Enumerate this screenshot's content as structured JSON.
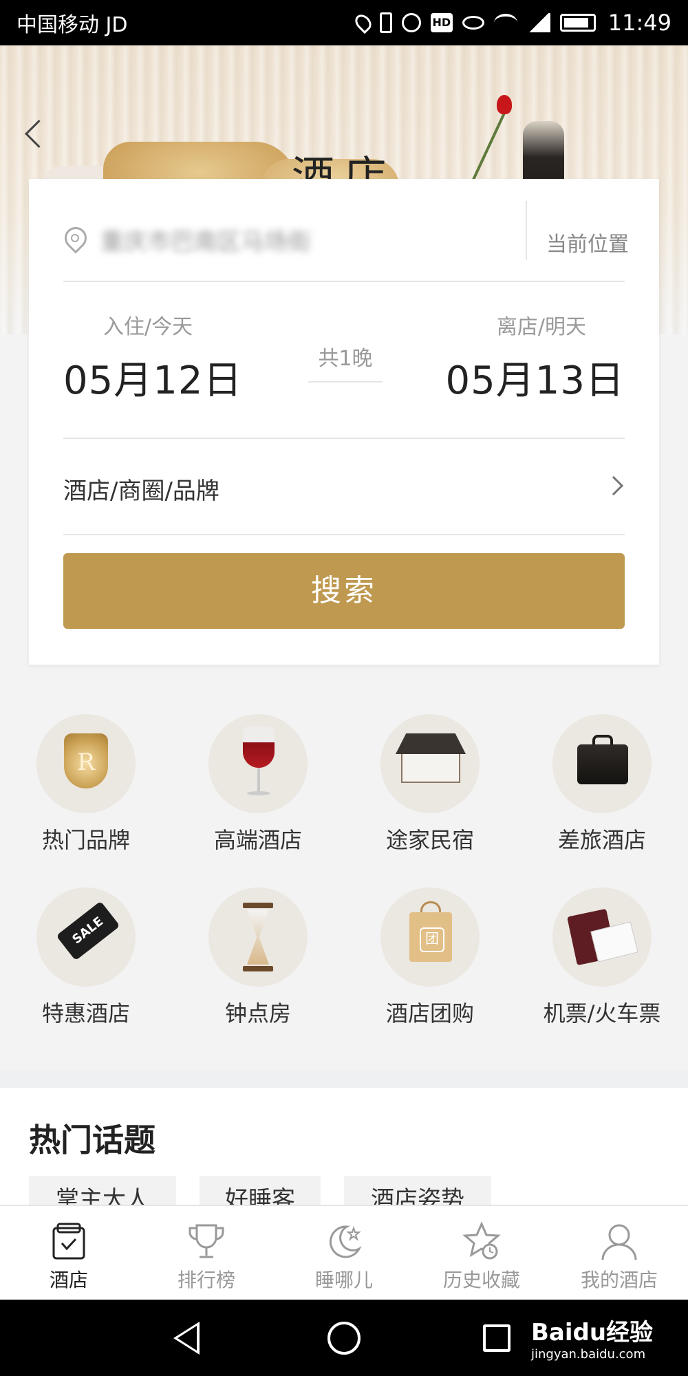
{
  "status_bar": {
    "carrier": "中国移动 JD",
    "hd": "HD",
    "time": "11:49"
  },
  "header": {
    "title": "酒店"
  },
  "search_card": {
    "location_text": "重庆市巴南区马场街",
    "current_location": "当前位置",
    "checkin": {
      "label": "入住/今天",
      "date": "05月12日"
    },
    "nights": "共1晚",
    "checkout": {
      "label": "离店/明天",
      "date": "05月13日"
    },
    "keyword_placeholder": "酒店/商圈/品牌",
    "search_button": "搜索"
  },
  "categories": [
    {
      "label": "热门品牌",
      "icon": "brand-crest-icon"
    },
    {
      "label": "高端酒店",
      "icon": "wine-glass-icon"
    },
    {
      "label": "途家民宿",
      "icon": "house-icon"
    },
    {
      "label": "差旅酒店",
      "icon": "briefcase-icon"
    },
    {
      "label": "特惠酒店",
      "icon": "sale-tag-icon",
      "badge": "SALE"
    },
    {
      "label": "钟点房",
      "icon": "hourglass-icon"
    },
    {
      "label": "酒店团购",
      "icon": "shopping-bag-icon"
    },
    {
      "label": "机票/火车票",
      "icon": "passport-ticket-icon"
    }
  ],
  "topics": {
    "title": "热门话题",
    "chips": [
      "掌主大人",
      "好睡客",
      "酒店姿势"
    ]
  },
  "tabbar": {
    "items": [
      {
        "label": "酒店",
        "icon": "hotel-calendar-icon",
        "active": true
      },
      {
        "label": "排行榜",
        "icon": "trophy-icon",
        "active": false
      },
      {
        "label": "睡哪儿",
        "icon": "moon-star-icon",
        "active": false
      },
      {
        "label": "历史收藏",
        "icon": "star-clock-icon",
        "active": false
      },
      {
        "label": "我的酒店",
        "icon": "person-icon",
        "active": false
      }
    ]
  },
  "watermark": {
    "main": "Baidu经验",
    "sub": "jingyan.baidu.com"
  },
  "colors": {
    "accent": "#bf994f",
    "status_bar": "#000000",
    "nav_bar": "#000000"
  }
}
